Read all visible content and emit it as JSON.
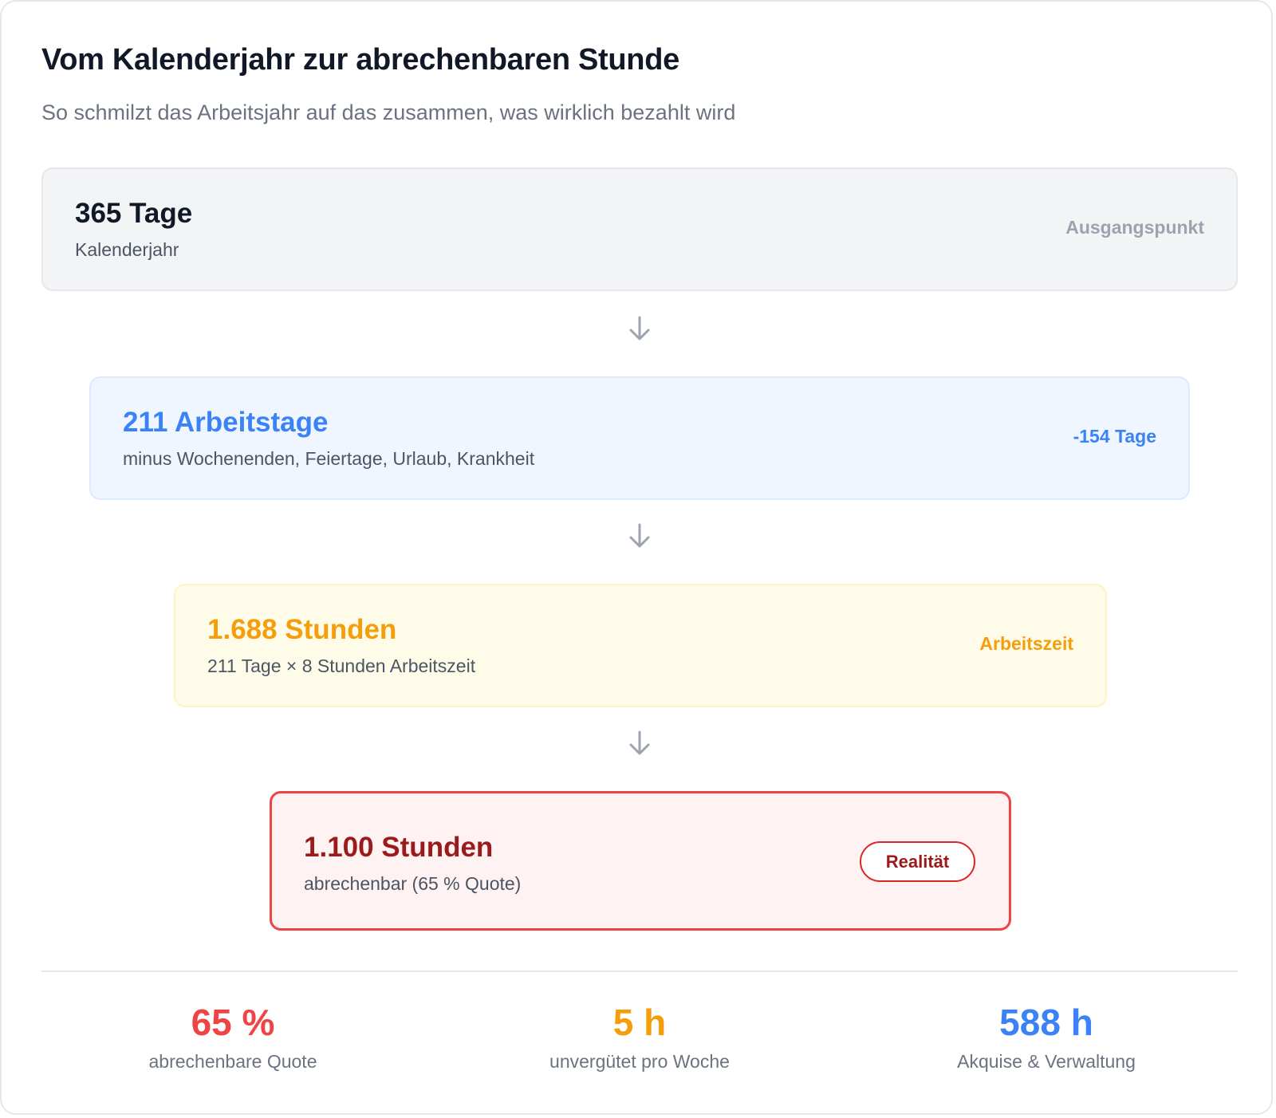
{
  "header": {
    "title": "Vom Kalenderjahr zur abrechenbaren Stunde",
    "subtitle": "So schmilzt das Arbeitsjahr auf das zusammen, was wirklich bezahlt wird"
  },
  "steps": [
    {
      "value": "365 Tage",
      "description": "Kalenderjahr",
      "tag": "Ausgangspunkt",
      "color": "#111827"
    },
    {
      "value": "211 Arbeitstage",
      "description": "minus Wochenenden, Feiertage, Urlaub, Krankheit",
      "tag": "-154 Tage",
      "color": "#3b82f6"
    },
    {
      "value": "1.688 Stunden",
      "description": "211 Tage × 8 Stunden Arbeitszeit",
      "tag": "Arbeitszeit",
      "color": "#f59e0b"
    },
    {
      "value": "1.100 Stunden",
      "description": "abrechenbar (65 % Quote)",
      "tag": "Realität",
      "color": "#991b1b"
    }
  ],
  "stats": [
    {
      "value": "65 %",
      "label": "abrechenbare Quote",
      "color": "#ef4444"
    },
    {
      "value": "5 h",
      "label": "unvergütet pro Woche",
      "color": "#f59e0b"
    },
    {
      "value": "588 h",
      "label": "Akquise & Verwaltung",
      "color": "#3b82f6"
    }
  ],
  "icons": {
    "connector": "arrow-down-icon"
  }
}
